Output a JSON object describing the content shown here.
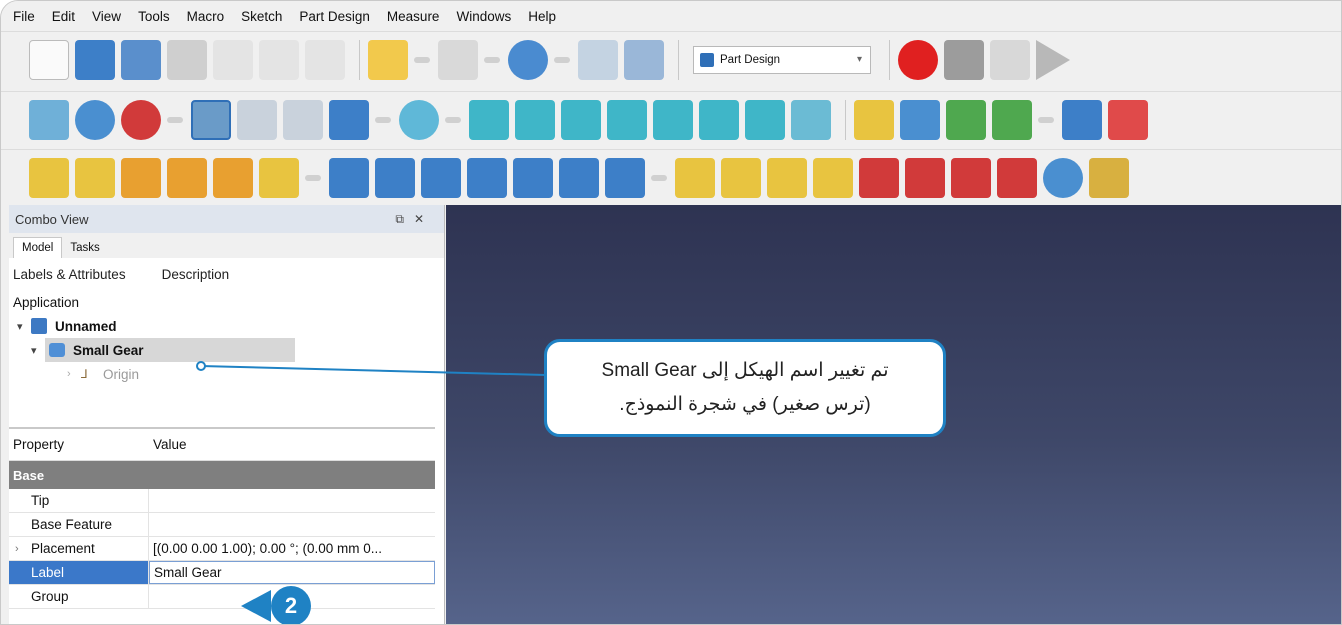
{
  "menu": [
    "File",
    "Edit",
    "View",
    "Tools",
    "Macro",
    "Sketch",
    "Part Design",
    "Measure",
    "Windows",
    "Help"
  ],
  "toolbar": {
    "workbench_label": "Part Design"
  },
  "combo": {
    "title": "Combo View",
    "tabs": [
      "Model",
      "Tasks"
    ],
    "tree_columns": [
      "Labels & Attributes",
      "Description"
    ],
    "application_label": "Application",
    "document": "Unnamed",
    "body": "Small Gear",
    "origin": "Origin"
  },
  "properties": {
    "col_property": "Property",
    "col_value": "Value",
    "group": "Base",
    "rows": [
      {
        "key": "Tip",
        "value": ""
      },
      {
        "key": "Base Feature",
        "value": ""
      },
      {
        "key": "Placement",
        "value": "[(0.00 0.00 1.00); 0.00 °; (0.00 mm  0..."
      },
      {
        "key": "Label",
        "value": "Small Gear"
      },
      {
        "key": "Group",
        "value": ""
      }
    ]
  },
  "callout": {
    "line1": "تم تغيير اسم الهيكل إلى Small Gear",
    "line2": "(ترس صغير) في شجرة النموذج."
  },
  "step_number": "2",
  "colors": {
    "accent": "#1f82c4",
    "selection": "#3b78c9",
    "view_top": "#2e3352",
    "view_bottom": "#56648b"
  }
}
